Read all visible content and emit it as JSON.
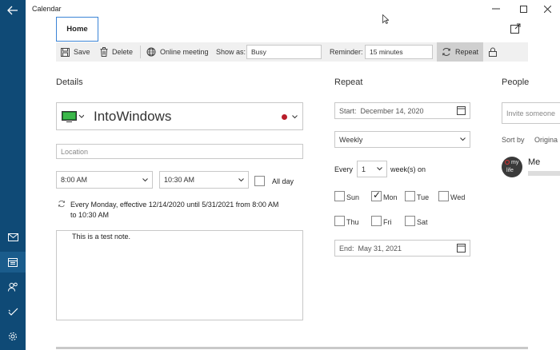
{
  "app": {
    "title": "Calendar"
  },
  "ribbon": {
    "active_tab": "Home"
  },
  "toolbar": {
    "save_label": "Save",
    "delete_label": "Delete",
    "online_meeting_label": "Online meeting",
    "show_as_label": "Show as:",
    "show_as_value": "Busy",
    "reminder_label": "Reminder:",
    "reminder_value": "15 minutes",
    "repeat_label": "Repeat"
  },
  "details": {
    "heading": "Details",
    "event_title": "IntoWindows",
    "calendar_color": "#b81d2a",
    "location_placeholder": "Location",
    "start_time": "8:00 AM",
    "end_time": "10:30 AM",
    "all_day_label": "All day",
    "recurrence_summary_line1": "Every Monday, effective 12/14/2020 until 5/31/2021 from 8:00 AM",
    "recurrence_summary_line2": "to 10:30 AM",
    "notes": "This is a test note."
  },
  "repeat": {
    "heading": "Repeat",
    "start_label": "Start:",
    "start_date": "December 14, 2020",
    "frequency": "Weekly",
    "every_label": "Every",
    "interval": "1",
    "interval_unit": "week(s) on",
    "days": [
      {
        "label": "Sun",
        "checked": false
      },
      {
        "label": "Mon",
        "checked": true
      },
      {
        "label": "Tue",
        "checked": false
      },
      {
        "label": "Wed",
        "checked": false
      },
      {
        "label": "Thu",
        "checked": false
      },
      {
        "label": "Fri",
        "checked": false
      },
      {
        "label": "Sat",
        "checked": false
      }
    ],
    "end_label": "End:",
    "end_date": "May 31, 2021"
  },
  "people": {
    "heading": "People",
    "invite_placeholder": "Invite someone",
    "sort_by_label": "Sort by",
    "sort_by_value": "Origina",
    "attendee_name": "Me",
    "avatar_text_1": "my",
    "avatar_text_2": "life"
  },
  "colors": {
    "sidebar": "#0f4a76",
    "accent": "#3b84d6",
    "toolbar_bg": "#f0f0f0"
  }
}
